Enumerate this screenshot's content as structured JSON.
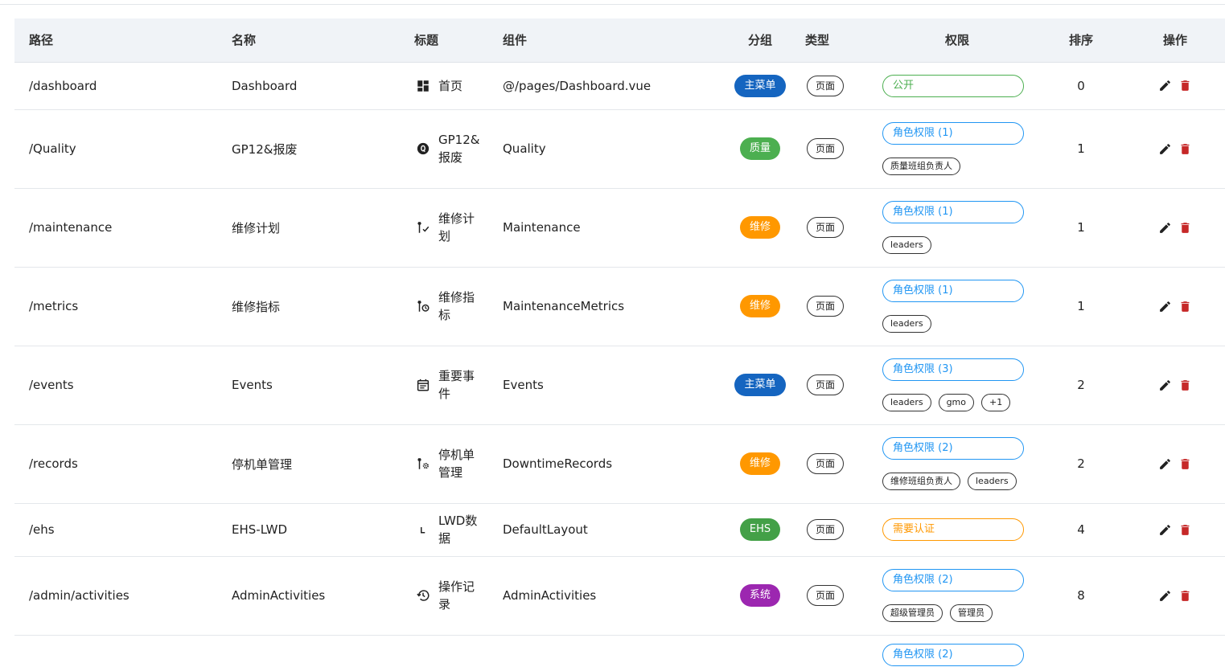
{
  "columns": {
    "path": "路径",
    "name": "名称",
    "title": "标题",
    "component": "组件",
    "group": "分组",
    "type": "类型",
    "permission": "权限",
    "order": "排序",
    "actions": "操作"
  },
  "group_colors": {
    "主菜单": "#1565c0",
    "质量": "#4caf50",
    "维修": "#ff9800",
    "EHS": "#43a047",
    "系统": "#9c27b0"
  },
  "rows": [
    {
      "path": "/dashboard",
      "name": "Dashboard",
      "icon": "dashboard-icon",
      "title": "首页",
      "component": "@/pages/Dashboard.vue",
      "group": "主菜单",
      "type": "页面",
      "permission": "公开",
      "perm_kind": "public",
      "roles": [],
      "order": "0"
    },
    {
      "path": "/Quality",
      "name": "GP12&报废",
      "icon": "alpha-q-circle-icon",
      "title": "GP12&报废",
      "component": "Quality",
      "group": "质量",
      "type": "页面",
      "permission": "角色权限 (1)",
      "perm_kind": "role",
      "roles": [
        "质量班组负责人"
      ],
      "order": "1"
    },
    {
      "path": "/maintenance",
      "name": "维修计划",
      "icon": "wrench-check-icon",
      "title": "维修计划",
      "component": "Maintenance",
      "group": "维修",
      "type": "页面",
      "permission": "角色权限 (1)",
      "perm_kind": "role",
      "roles": [
        "leaders"
      ],
      "order": "1"
    },
    {
      "path": "/metrics",
      "name": "维修指标",
      "icon": "wrench-clock-icon",
      "title": "维修指标",
      "component": "MaintenanceMetrics",
      "group": "维修",
      "type": "页面",
      "permission": "角色权限 (1)",
      "perm_kind": "role",
      "roles": [
        "leaders"
      ],
      "order": "1"
    },
    {
      "path": "/events",
      "name": "Events",
      "icon": "calendar-text-icon",
      "title": "重要事件",
      "component": "Events",
      "group": "主菜单",
      "type": "页面",
      "permission": "角色权限 (3)",
      "perm_kind": "role",
      "roles": [
        "leaders",
        "gmo",
        "+1"
      ],
      "order": "2"
    },
    {
      "path": "/records",
      "name": "停机单管理",
      "icon": "wrench-cog-icon",
      "title": "停机单管理",
      "component": "DowntimeRecords",
      "group": "维修",
      "type": "页面",
      "permission": "角色权限 (2)",
      "perm_kind": "role",
      "roles": [
        "维修班组负责人",
        "leaders"
      ],
      "order": "2"
    },
    {
      "path": "/ehs",
      "name": "EHS-LWD",
      "icon": "letter-l-icon",
      "title": "LWD数据",
      "component": "DefaultLayout",
      "group": "EHS",
      "type": "页面",
      "permission": "需要认证",
      "perm_kind": "auth",
      "roles": [],
      "order": "4"
    },
    {
      "path": "/admin/activities",
      "name": "AdminActivities",
      "icon": "history-icon",
      "title": "操作记录",
      "component": "AdminActivities",
      "group": "系统",
      "type": "页面",
      "permission": "角色权限 (2)",
      "perm_kind": "role",
      "roles": [
        "超级管理员",
        "管理员"
      ],
      "order": "8"
    },
    {
      "path": "",
      "name": "",
      "icon": "",
      "title": "",
      "component": "",
      "group": "",
      "type": "",
      "permission": "角色权限 (2)",
      "perm_kind": "role",
      "roles": [],
      "order": ""
    }
  ]
}
